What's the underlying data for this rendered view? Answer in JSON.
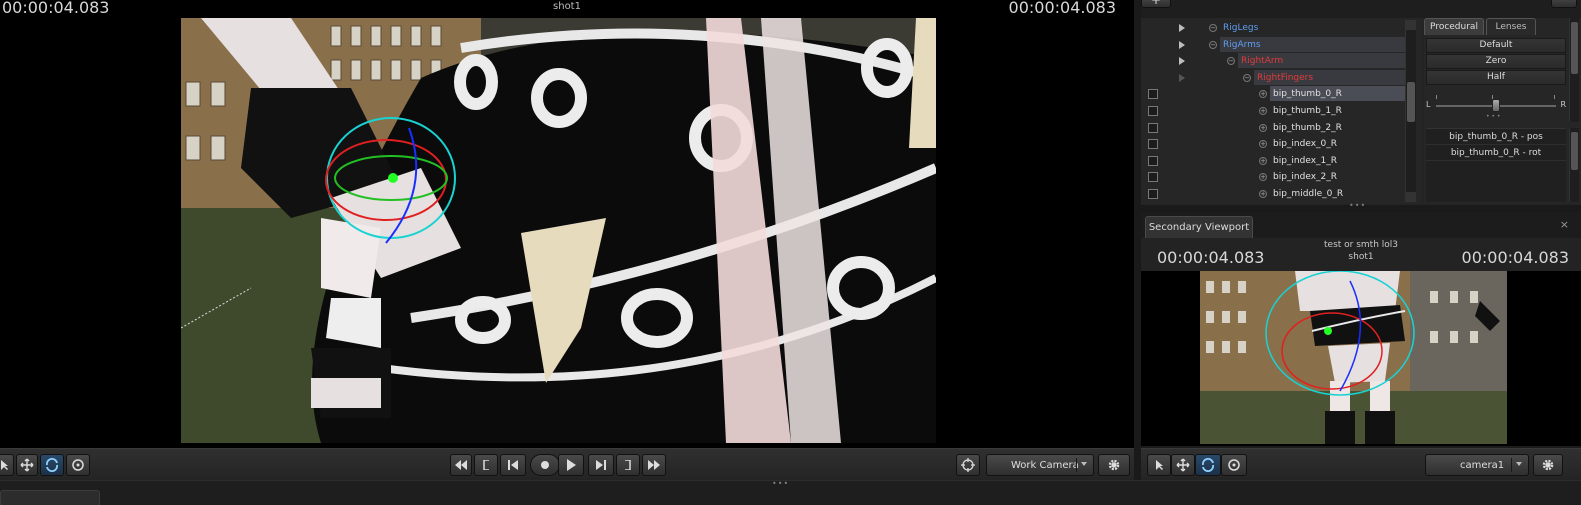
{
  "main_viewport": {
    "timecode_left": "00:00:04.083",
    "timecode_right": "00:00:04.083",
    "shot_name": "shot1"
  },
  "main_toolbar": {
    "camera_dropdown": "Work Camera",
    "icons": [
      "select-arrow-icon",
      "move-icon",
      "rotate-icon",
      "scale-icon",
      "rewind-icon",
      "prev-key-icon",
      "step-back-icon",
      "stop-icon",
      "play-icon",
      "step-forward-icon",
      "next-key-icon",
      "fast-forward-icon",
      "target-icon",
      "gear-icon"
    ]
  },
  "tree": {
    "rows": [
      {
        "label": "RigLegs",
        "color": "blue",
        "indent": 1,
        "has_checkbox": false,
        "has_triangle": true
      },
      {
        "label": "RigArms",
        "color": "blue",
        "indent": 1,
        "has_checkbox": false,
        "has_triangle": true
      },
      {
        "label": "RightArm",
        "color": "red",
        "indent": 2,
        "has_checkbox": false,
        "has_triangle": true
      },
      {
        "label": "RightFingers",
        "color": "red",
        "indent": 3,
        "has_checkbox": false,
        "has_triangle": true
      },
      {
        "label": "bip_thumb_0_R",
        "color": "white",
        "indent": 4,
        "has_checkbox": true,
        "selected": true
      },
      {
        "label": "bip_thumb_1_R",
        "color": "white",
        "indent": 4,
        "has_checkbox": true
      },
      {
        "label": "bip_thumb_2_R",
        "color": "white",
        "indent": 4,
        "has_checkbox": true
      },
      {
        "label": "bip_index_0_R",
        "color": "white",
        "indent": 4,
        "has_checkbox": true
      },
      {
        "label": "bip_index_1_R",
        "color": "white",
        "indent": 4,
        "has_checkbox": true
      },
      {
        "label": "bip_index_2_R",
        "color": "white",
        "indent": 4,
        "has_checkbox": true
      },
      {
        "label": "bip_middle_0_R",
        "color": "white",
        "indent": 4,
        "has_checkbox": true
      }
    ]
  },
  "procedural": {
    "tab_procedural": "Procedural",
    "tab_lenses": "Lenses",
    "presets": [
      "Default",
      "Zero",
      "Half"
    ],
    "slider_left": "L",
    "slider_right": "R",
    "slider_value": 0.5,
    "channels": [
      "bip_thumb_0_R - pos",
      "bip_thumb_0_R - rot"
    ]
  },
  "secondary": {
    "tab_label": "Secondary Viewport",
    "close_glyph": "×",
    "title": "test or smth lol3",
    "shot_name": "shot1",
    "timecode_left": "00:00:04.083",
    "timecode_right": "00:00:04.083",
    "camera_dropdown": "camera1"
  },
  "colors": {
    "accent_blue": "#5f9df0",
    "accent_red": "#e23a3a",
    "panel": "#242424",
    "gizmo_cyan": "#19d3d3",
    "gizmo_green": "#22ff22"
  }
}
